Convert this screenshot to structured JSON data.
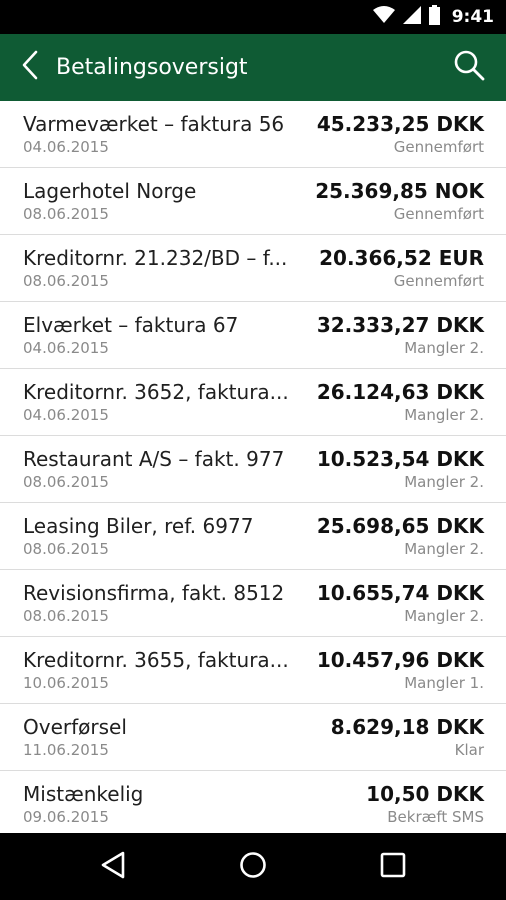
{
  "status_bar": {
    "time": "9:41",
    "icons": [
      "wifi-icon",
      "signal-icon",
      "battery-icon"
    ]
  },
  "app_bar": {
    "title": "Betalingsoversigt",
    "background_color": "#0f5b34",
    "back_icon": "chevron-left-icon",
    "search_icon": "search-icon"
  },
  "payments": [
    {
      "title": "Varmeværket – faktura 56",
      "date": "04.06.2015",
      "amount": "45.233,25 DKK",
      "status": "Gennemført"
    },
    {
      "title": "Lagerhotel Norge",
      "date": "08.06.2015",
      "amount": "25.369,85 NOK",
      "status": "Gennemført"
    },
    {
      "title": "Kreditornr. 21.232/BD – f...",
      "date": "08.06.2015",
      "amount": "20.366,52 EUR",
      "status": "Gennemført"
    },
    {
      "title": "Elværket – faktura 67",
      "date": "04.06.2015",
      "amount": "32.333,27 DKK",
      "status": "Mangler 2."
    },
    {
      "title": "Kreditornr. 3652, faktura...",
      "date": "04.06.2015",
      "amount": "26.124,63 DKK",
      "status": "Mangler 2."
    },
    {
      "title": "Restaurant A/S – fakt. 977",
      "date": "08.06.2015",
      "amount": "10.523,54 DKK",
      "status": "Mangler 2."
    },
    {
      "title": "Leasing Biler, ref. 6977",
      "date": "08.06.2015",
      "amount": "25.698,65 DKK",
      "status": "Mangler 2."
    },
    {
      "title": "Revisionsfirma, fakt. 8512",
      "date": "08.06.2015",
      "amount": "10.655,74 DKK",
      "status": "Mangler 2."
    },
    {
      "title": "Kreditornr. 3655, faktura...",
      "date": "10.06.2015",
      "amount": "10.457,96 DKK",
      "status": "Mangler 1."
    },
    {
      "title": "Overførsel",
      "date": "11.06.2015",
      "amount": "8.629,18 DKK",
      "status": "Klar"
    },
    {
      "title": "Mistænkelig",
      "date": "09.06.2015",
      "amount": "10,50 DKK",
      "status": "Bekræft SMS"
    }
  ],
  "nav_bar": {
    "icons": [
      "back-triangle-icon",
      "home-circle-icon",
      "recents-square-icon"
    ]
  }
}
